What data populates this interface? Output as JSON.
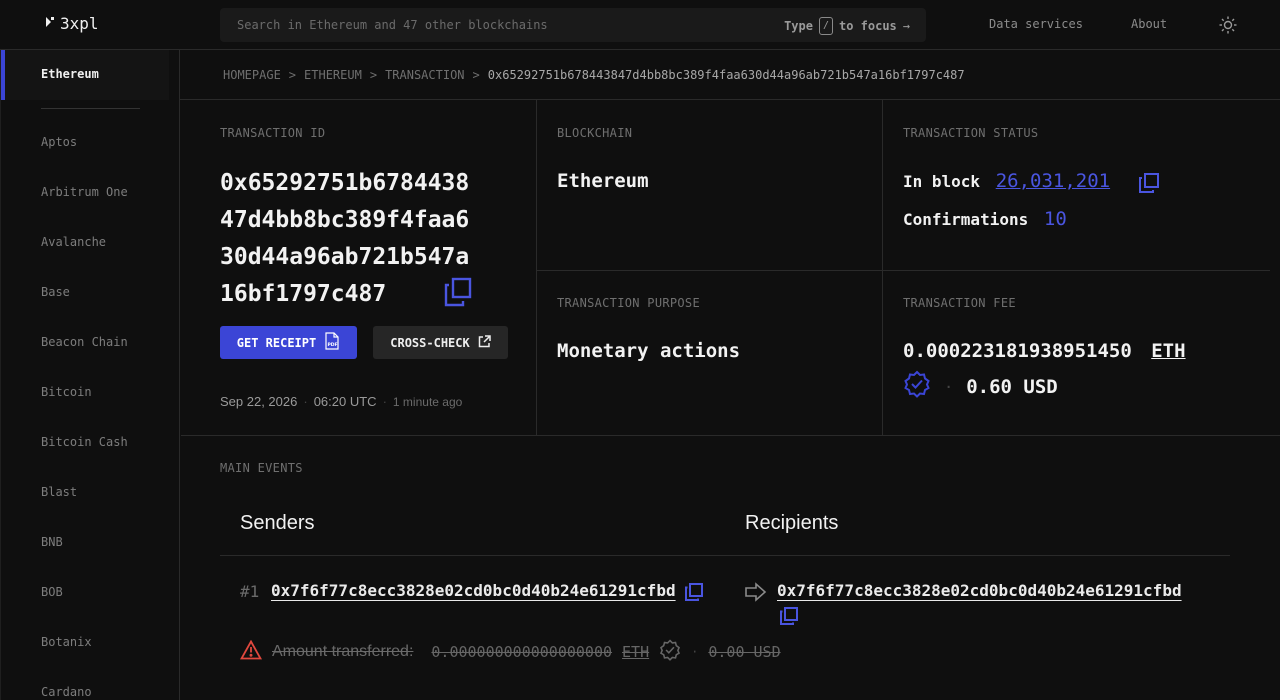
{
  "header": {
    "logo": "3xpl",
    "search_placeholder": "Search in Ethereum and 47 other blockchains",
    "search_hint_pre": "Type",
    "search_hint_key": "/",
    "search_hint_post": "to focus",
    "search_hint_arrow": "→",
    "nav": [
      "Data services",
      "About"
    ]
  },
  "sidebar": {
    "active": "Ethereum",
    "items": [
      "Aptos",
      "Arbitrum One",
      "Avalanche",
      "Base",
      "Beacon Chain",
      "Bitcoin",
      "Bitcoin Cash",
      "Blast",
      "BNB",
      "BOB",
      "Botanix",
      "Cardano"
    ]
  },
  "breadcrumb": {
    "items": [
      "HOMEPAGE",
      "ETHEREUM",
      "TRANSACTION"
    ],
    "separator": ">",
    "current": "0x65292751b678443847d4bb8bc389f4faa630d44a96ab721b547a16bf1797c487"
  },
  "transaction": {
    "id_label": "TRANSACTION ID",
    "id": "0x65292751b678443847d4bb8bc389f4faa630d44a96ab721b547a16bf1797c487",
    "receipt_label": "GET RECEIPT",
    "crosscheck_label": "CROSS-CHECK",
    "date": "Sep 22, 2026",
    "time": "06:20 UTC",
    "ago": "1 minute ago"
  },
  "blockchain": {
    "label": "BLOCKCHAIN",
    "value": "Ethereum"
  },
  "purpose": {
    "label": "TRANSACTION PURPOSE",
    "value": "Monetary actions"
  },
  "status": {
    "label": "TRANSACTION STATUS",
    "block_label": "In block",
    "block": "26,031,201",
    "confirmations_label": "Confirmations",
    "confirmations": "10"
  },
  "fee": {
    "label": "TRANSACTION FEE",
    "amount": "0.000223181938951450",
    "currency": "ETH",
    "usd": "0.60 USD"
  },
  "events": {
    "title": "MAIN EVENTS",
    "senders_title": "Senders",
    "recipients_title": "Recipients",
    "index": "#1",
    "sender": "0x7f6f77c8ecc3828e02cd0bc0d40b24e61291cfbd",
    "recipient": "0x7f6f77c8ecc3828e02cd0bc0d40b24e61291cfbd",
    "amount_label": "Amount transferred:",
    "amount": "0.000000000000000000",
    "amount_currency": "ETH",
    "amount_usd": "0.00 USD"
  },
  "colors": {
    "accent": "#3b45d6",
    "link": "#4a55e0",
    "warning": "#e0483e"
  }
}
